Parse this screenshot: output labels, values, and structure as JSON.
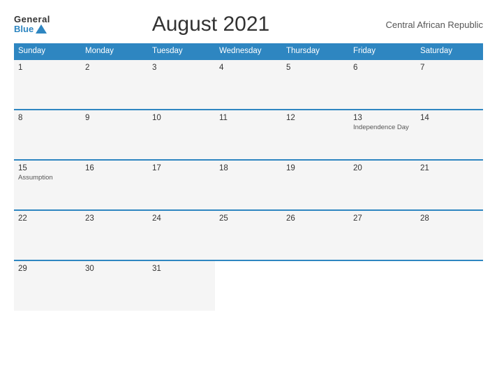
{
  "header": {
    "logo_general": "General",
    "logo_blue": "Blue",
    "title": "August 2021",
    "country": "Central African Republic"
  },
  "weekdays": [
    "Sunday",
    "Monday",
    "Tuesday",
    "Wednesday",
    "Thursday",
    "Friday",
    "Saturday"
  ],
  "weeks": [
    [
      {
        "day": "1",
        "holiday": ""
      },
      {
        "day": "2",
        "holiday": ""
      },
      {
        "day": "3",
        "holiday": ""
      },
      {
        "day": "4",
        "holiday": ""
      },
      {
        "day": "5",
        "holiday": ""
      },
      {
        "day": "6",
        "holiday": ""
      },
      {
        "day": "7",
        "holiday": ""
      }
    ],
    [
      {
        "day": "8",
        "holiday": ""
      },
      {
        "day": "9",
        "holiday": ""
      },
      {
        "day": "10",
        "holiday": ""
      },
      {
        "day": "11",
        "holiday": ""
      },
      {
        "day": "12",
        "holiday": ""
      },
      {
        "day": "13",
        "holiday": "Independence Day"
      },
      {
        "day": "14",
        "holiday": ""
      }
    ],
    [
      {
        "day": "15",
        "holiday": "Assumption"
      },
      {
        "day": "16",
        "holiday": ""
      },
      {
        "day": "17",
        "holiday": ""
      },
      {
        "day": "18",
        "holiday": ""
      },
      {
        "day": "19",
        "holiday": ""
      },
      {
        "day": "20",
        "holiday": ""
      },
      {
        "day": "21",
        "holiday": ""
      }
    ],
    [
      {
        "day": "22",
        "holiday": ""
      },
      {
        "day": "23",
        "holiday": ""
      },
      {
        "day": "24",
        "holiday": ""
      },
      {
        "day": "25",
        "holiday": ""
      },
      {
        "day": "26",
        "holiday": ""
      },
      {
        "day": "27",
        "holiday": ""
      },
      {
        "day": "28",
        "holiday": ""
      }
    ],
    [
      {
        "day": "29",
        "holiday": ""
      },
      {
        "day": "30",
        "holiday": ""
      },
      {
        "day": "31",
        "holiday": ""
      },
      {
        "day": "",
        "holiday": ""
      },
      {
        "day": "",
        "holiday": ""
      },
      {
        "day": "",
        "holiday": ""
      },
      {
        "day": "",
        "holiday": ""
      }
    ]
  ]
}
